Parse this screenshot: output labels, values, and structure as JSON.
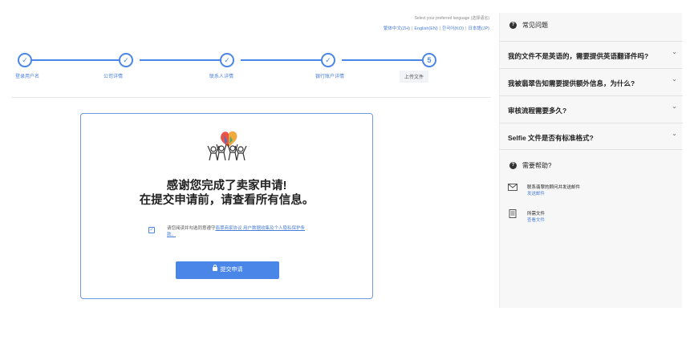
{
  "language": {
    "hint": "Select your preferred language (选择语言)",
    "options": [
      "繁体中文(ZH)",
      "English(EN)",
      "한국어(KO)",
      "日本語(JP)"
    ]
  },
  "steps": [
    {
      "label": "登录用户名",
      "mark": "✓"
    },
    {
      "label": "公司详情",
      "mark": "✓"
    },
    {
      "label": "联系人详情",
      "mark": "✓"
    },
    {
      "label": "银行账户详情",
      "mark": "✓"
    },
    {
      "label": "上传文件",
      "mark": "5"
    }
  ],
  "card": {
    "title_line1": "感谢您完成了卖家申请!",
    "title_line2": "在提交申请前，请查看所有信息。",
    "agree_prefix": "请您阅读并勾选同意遵守",
    "agree_link": "翡翠商家协议 用户数据收集及个人隐私保护条款。",
    "checkbox_mark": "✓",
    "submit_label": "提交申请"
  },
  "faq": {
    "heading": "常见问题",
    "items": [
      "我的文件不是英语的，需要提供英语翻译件吗?",
      "我被翡翠告知需要提供额外信息，为什么?",
      "审核流程需要多久?",
      "Selfie 文件是否有标准格式?"
    ]
  },
  "help": {
    "heading": "需要帮助?",
    "items": [
      {
        "title": "联系翡翠的顾问并发送邮件",
        "link": "发送邮件",
        "icon": "mail-icon"
      },
      {
        "title": "所需文件",
        "link": "查看文件",
        "icon": "document-icon"
      }
    ]
  },
  "colors": {
    "accent": "#4a86e8",
    "link": "#4a7fd6"
  }
}
